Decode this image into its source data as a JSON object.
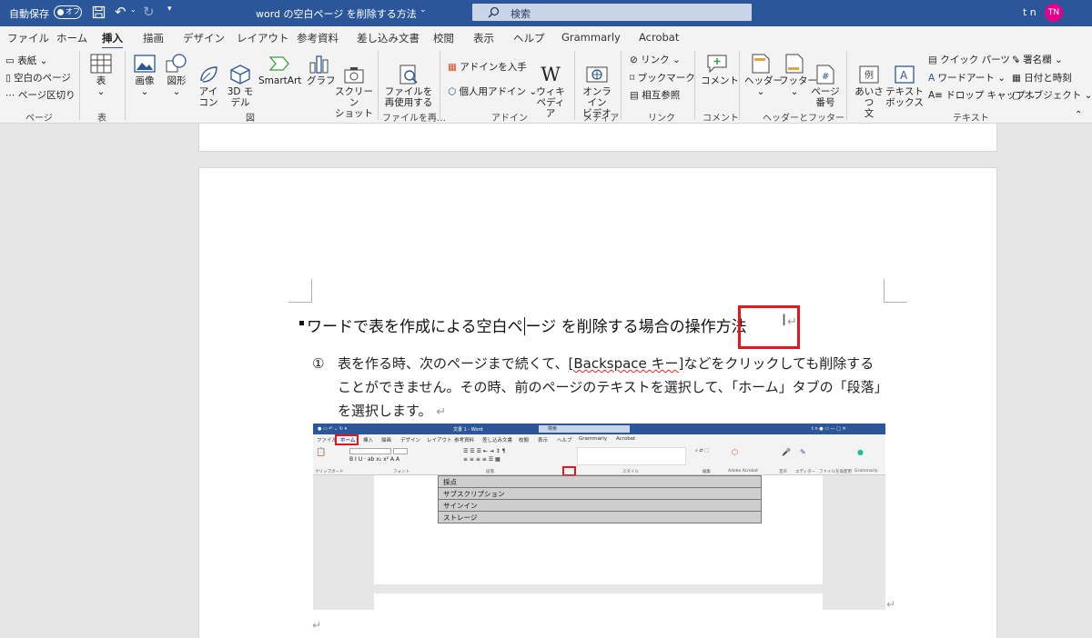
{
  "titlebar": {
    "autosave_label": "自動保存",
    "autosave_state": "オフ",
    "doc_title": "word の空白ページ を削除する方法",
    "search_placeholder": "検索",
    "user_name": "t n",
    "user_initials": "TN"
  },
  "tabs": [
    "ファイル",
    "ホーム",
    "挿入",
    "描画",
    "デザイン",
    "レイアウト",
    "参考資料",
    "差し込み文書",
    "校閲",
    "表示",
    "ヘルプ",
    "Grammarly",
    "Acrobat"
  ],
  "ribbon": {
    "pages": {
      "cover": "表紙",
      "blank": "空白のページ",
      "break": "ページ区切り",
      "group": "ページ"
    },
    "table": {
      "label": "表",
      "group": "表"
    },
    "illustrations": {
      "picture": "画像",
      "shapes": "図形",
      "icons": "アイ\nコン",
      "models": "3D モ\nデル",
      "smartart": "SmartArt",
      "chart": "グラフ",
      "screenshot": "スクリーン\nショット",
      "group": "図"
    },
    "reuse": {
      "label": "ファイルを\n再使用する",
      "group": "ファイルを再…"
    },
    "addins": {
      "get": "アドインを入手",
      "my": "個人用アドイン",
      "wiki": "ウィキ\nペディア",
      "group": "アドイン"
    },
    "media": {
      "video": "オンライン\nビデオ",
      "group": "メディア"
    },
    "links": {
      "link": "リンク",
      "bookmark": "ブックマーク",
      "crossref": "相互参照",
      "group": "リンク"
    },
    "comments": {
      "comment": "コメント",
      "group": "コメント"
    },
    "headerfooter": {
      "header": "ヘッダー",
      "footer": "フッター",
      "pagenum": "ページ\n番号",
      "group": "ヘッダーとフッター"
    },
    "text": {
      "greeting": "あいさつ\n文",
      "textbox": "テキスト\nボックス",
      "quickparts": "クイック パーツ",
      "wordart": "ワードアート",
      "dropcap": "ドロップ キャップ",
      "signature": "署名欄",
      "datetime": "日付と時刻",
      "object": "オブジェクト",
      "group": "テキスト"
    }
  },
  "document": {
    "heading_before_caret": "ワードで表を作成による空白ペ",
    "heading_after_caret": "ージ を削除する場合の操作方法",
    "para_number": "①",
    "para_text_1": "表を作る時、次のページまで続くて、",
    "para_squiggle": "[Backspace キー]",
    "para_text_2": "などをクリックしても削除することができません。その時、前のページのテキストを選択して、「ホーム」タブの「段落」を選択します。"
  },
  "embedded": {
    "title": "文書 1 - Word",
    "search": "検索",
    "tabs": [
      "ファイル",
      "ホーム",
      "挿入",
      "描画",
      "デザイン",
      "レイアウト",
      "参考資料",
      "差し込み文書",
      "校閲",
      "表示",
      "ヘルプ",
      "Grammarly",
      "Acrobat"
    ],
    "groups": [
      "クリップボード",
      "フォント",
      "段落",
      "スタイル",
      "編集",
      "Adobe Acrobat",
      "音声",
      "エディター",
      "ファイルを再使用",
      "Grammarly"
    ],
    "table_rows": [
      "採点",
      "サブスクリプション",
      "サインイン",
      "ストレージ"
    ]
  },
  "colors": {
    "titlebar": "#2b579a",
    "highlight": "#e8141e",
    "avatar": "#e3008c"
  }
}
